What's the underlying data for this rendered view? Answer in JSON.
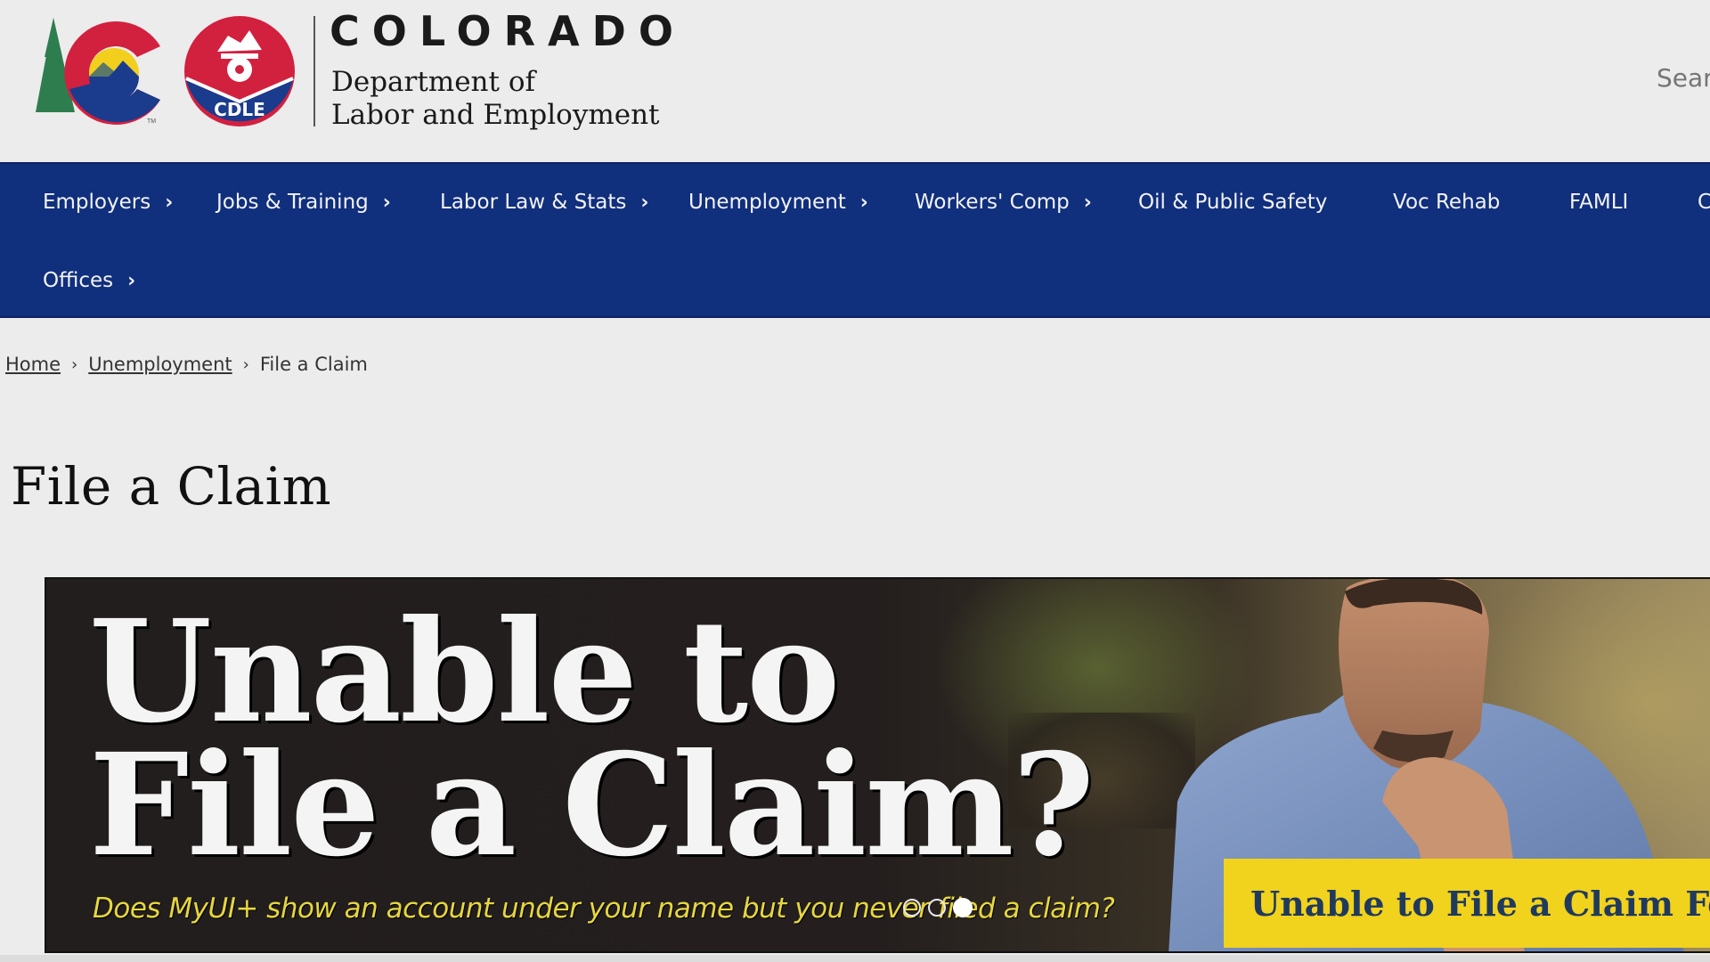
{
  "header": {
    "state_name": "COLORADO",
    "department_line1": "Department of",
    "department_line2": "Labor and Employment",
    "logo_co_label": "Colorado state logo",
    "logo_cdle_text": "CDLE",
    "logo_tm": "TM",
    "search_placeholder": "Search"
  },
  "nav": {
    "items": [
      {
        "label": "Employers",
        "has_submenu": true
      },
      {
        "label": "Jobs & Training",
        "has_submenu": true
      },
      {
        "label": "Labor Law & Stats",
        "has_submenu": true
      },
      {
        "label": "Unemployment",
        "has_submenu": true
      },
      {
        "label": "Workers' Comp",
        "has_submenu": true
      },
      {
        "label": "Oil & Public Safety",
        "has_submenu": false
      },
      {
        "label": "Voc Rehab",
        "has_submenu": false
      },
      {
        "label": "FAMLI",
        "has_submenu": false
      },
      {
        "label": "C",
        "has_submenu": false
      },
      {
        "label": "Offices",
        "has_submenu": true
      }
    ],
    "chevron": "›"
  },
  "breadcrumb": {
    "items": [
      {
        "label": "Home",
        "link": true
      },
      {
        "label": "Unemployment",
        "link": true
      },
      {
        "label": "File a Claim",
        "link": false
      }
    ],
    "separator": "›"
  },
  "page": {
    "title": "File a Claim"
  },
  "banner": {
    "headline_line1": "Unable to",
    "headline_line2": "File a Claim?",
    "subline": "Does MyUI+ show an account under your name but you never filed a claim?",
    "callout": "Unable to File a Claim Fo",
    "slides_total": 3,
    "active_slide": 3
  },
  "colors": {
    "nav_bg": "#102f7c",
    "banner_yellow": "#f1d21c",
    "subline_yellow": "#e6d640",
    "logo_red": "#d2203f",
    "logo_blue": "#1b3b8c",
    "logo_green": "#2e7d4f",
    "logo_gold": "#f2cf1d"
  }
}
